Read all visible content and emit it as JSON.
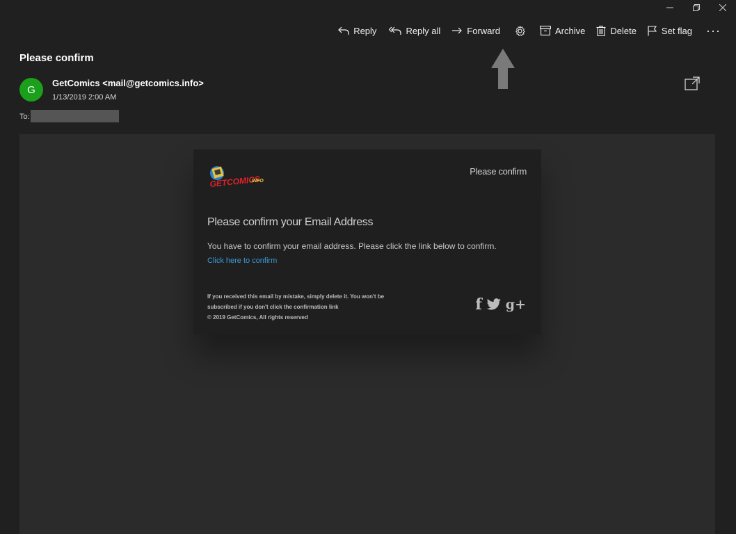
{
  "toolbar": {
    "reply": "Reply",
    "reply_all": "Reply all",
    "forward": "Forward",
    "settings_icon": "gear-icon",
    "archive": "Archive",
    "delete": "Delete",
    "set_flag": "Set flag",
    "more": "···"
  },
  "message": {
    "subject": "Please confirm",
    "avatar_letter": "G",
    "avatar_color": "#1aa01a",
    "sender": "GetComics <mail@getcomics.info>",
    "date": "1/13/2019 2:00 AM",
    "to_label": "To:"
  },
  "email": {
    "logo_text": "GETCOMICS.INFO",
    "header_right": "Please confirm",
    "heading": "Please confirm your Email Address",
    "paragraph": "You have to confirm your email address. Please click the link below to confirm.",
    "link": "Click here to confirm",
    "footer_line1": "If you received this email by mistake, simply delete it. You won't be",
    "footer_line2": "subscribed if you don't click the confirmation link",
    "footer_line3": "© 2019 GetComics, All rights reserved",
    "social": {
      "facebook": "f",
      "googleplus": "g+"
    }
  },
  "colors": {
    "background": "#202020",
    "pane": "#2b2b2b",
    "card": "#1f1f1f",
    "link": "#3a9bd9"
  }
}
